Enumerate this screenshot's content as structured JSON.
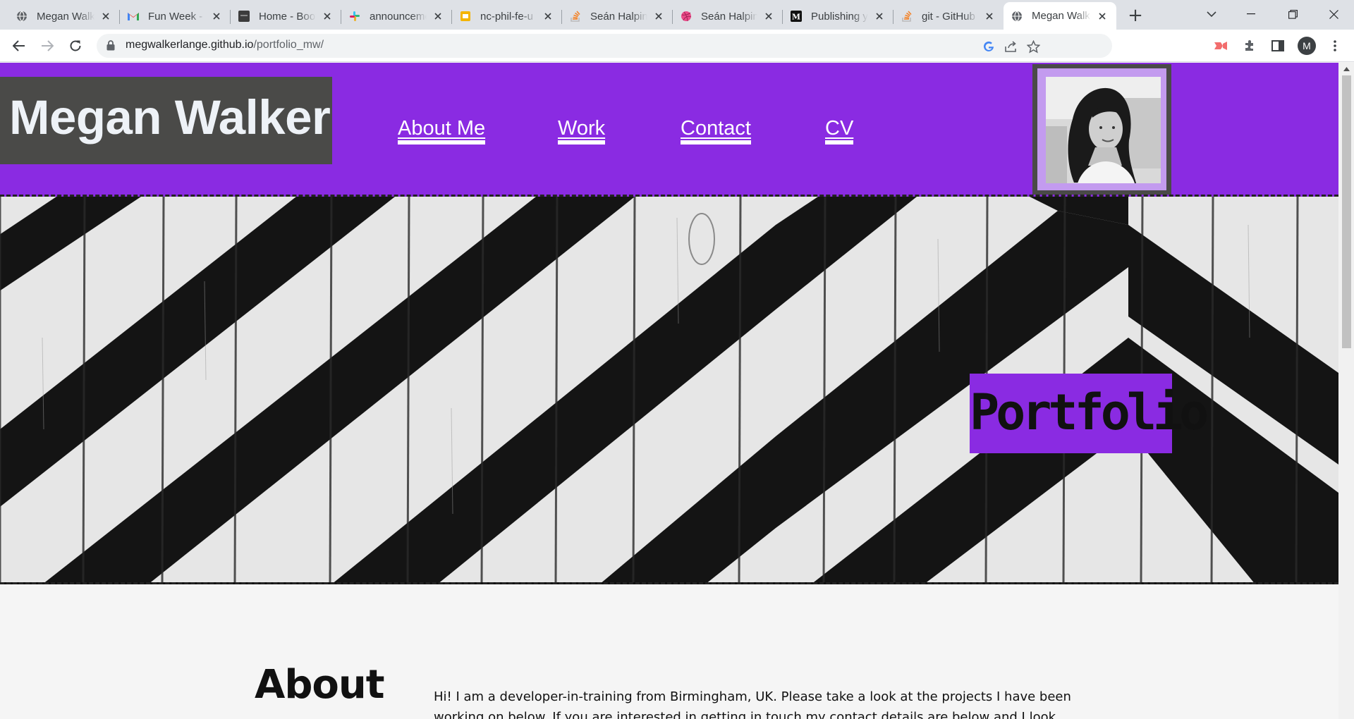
{
  "browser": {
    "tabs": [
      {
        "title": "Megan Walker",
        "icon": "globe-icon"
      },
      {
        "title": "Fun Week - ",
        "icon": "gmail-icon"
      },
      {
        "title": "Home - Bootcamp",
        "icon": "bootcamp-icon"
      },
      {
        "title": "announcements",
        "icon": "slack-icon"
      },
      {
        "title": "nc-phil-fe-u",
        "icon": "slides-icon"
      },
      {
        "title": "Seán Halpin",
        "icon": "stackoverflow-icon"
      },
      {
        "title": "Seán Halpin",
        "icon": "dribbble-icon"
      },
      {
        "title": "Publishing your",
        "icon": "medium-icon"
      },
      {
        "title": "git - GitHub",
        "icon": "stackoverflow-icon"
      },
      {
        "title": "Megan Walker",
        "icon": "globe-icon"
      }
    ],
    "active_tab_index": 9,
    "url_host": "megwalkerlange.github.io",
    "url_path": "/portfolio_mw/",
    "profile_initial": "M"
  },
  "site": {
    "logo": "Megan Walker",
    "nav": [
      {
        "label": "About Me"
      },
      {
        "label": "Work"
      },
      {
        "label": "Contact"
      },
      {
        "label": "CV"
      }
    ],
    "hero_title": "Portfolio",
    "about_heading": "About",
    "about_text": "Hi! I am a developer-in-training from Birmingham, UK. Please take a look at the projects I have been working on below. If you are interested in getting in touch my contact details are below and I look"
  },
  "colors": {
    "brand_purple": "#8a2be2",
    "logo_bg": "#4a4a48",
    "photo_border": "#c39bef"
  }
}
